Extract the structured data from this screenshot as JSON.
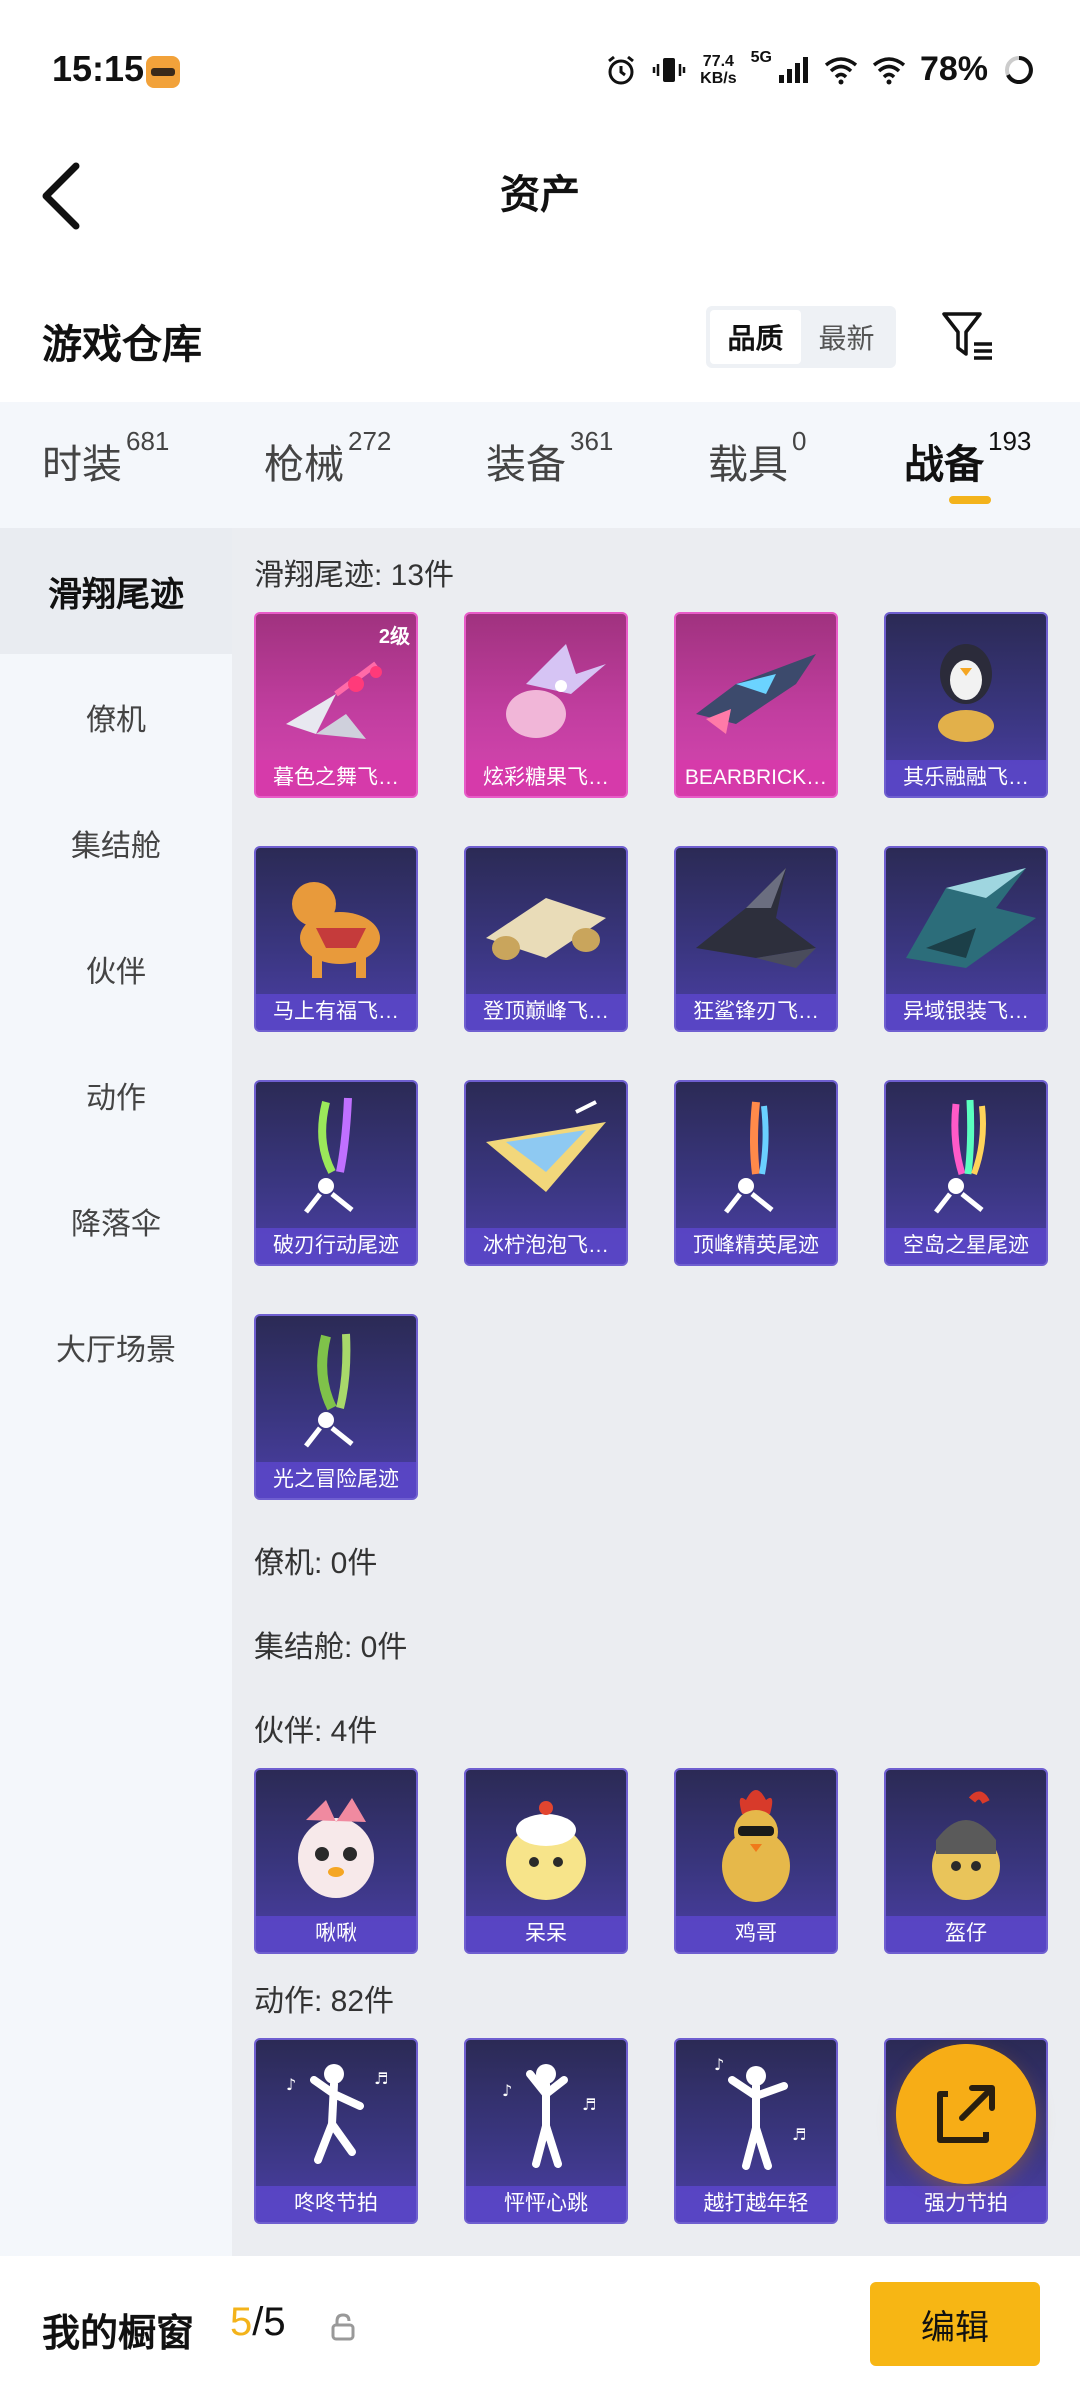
{
  "status_bar": {
    "time": "15:15",
    "net_speed_value": "77.4",
    "net_speed_unit": "KB/s",
    "network_type": "5G",
    "battery": "78%"
  },
  "header": {
    "title": "资产"
  },
  "warehouse": {
    "title": "游戏仓库",
    "sort_options": [
      "品质",
      "最新"
    ],
    "selected_sort": "品质"
  },
  "category_tabs": [
    {
      "label": "时装",
      "count": "681"
    },
    {
      "label": "枪械",
      "count": "272"
    },
    {
      "label": "装备",
      "count": "361"
    },
    {
      "label": "载具",
      "count": "0"
    },
    {
      "label": "战备",
      "count": "193",
      "active": true
    }
  ],
  "side_nav": [
    {
      "label": "滑翔尾迹",
      "active": true
    },
    {
      "label": "僚机"
    },
    {
      "label": "集结舱"
    },
    {
      "label": "伙伴"
    },
    {
      "label": "动作"
    },
    {
      "label": "降落伞"
    },
    {
      "label": "大厅场景"
    }
  ],
  "sections": {
    "glide_trails": {
      "label": "滑翔尾迹: 13件",
      "items": [
        {
          "name": "暮色之舞飞…",
          "level": "2级",
          "rarity": "pink"
        },
        {
          "name": "炫彩糖果飞…",
          "rarity": "pink"
        },
        {
          "name": "BEARBRICK…",
          "rarity": "pink"
        },
        {
          "name": "其乐融融飞…",
          "rarity": "purple"
        },
        {
          "name": "马上有福飞…",
          "rarity": "purple"
        },
        {
          "name": "登顶巅峰飞…",
          "rarity": "purple"
        },
        {
          "name": "狂鲨锋刃飞…",
          "rarity": "purple"
        },
        {
          "name": "异域银装飞…",
          "rarity": "purple"
        },
        {
          "name": "破刃行动尾迹",
          "rarity": "purple"
        },
        {
          "name": "冰柠泡泡飞…",
          "rarity": "purple"
        },
        {
          "name": "顶峰精英尾迹",
          "rarity": "purple"
        },
        {
          "name": "空岛之星尾迹",
          "rarity": "purple"
        },
        {
          "name": "光之冒险尾迹",
          "rarity": "purple"
        }
      ]
    },
    "wingman": {
      "label": "僚机: 0件"
    },
    "rally_pod": {
      "label": "集结舱: 0件"
    },
    "companions": {
      "label": "伙伴: 4件",
      "items": [
        {
          "name": "啾啾"
        },
        {
          "name": "呆呆"
        },
        {
          "name": "鸡哥"
        },
        {
          "name": "盔仔"
        }
      ]
    },
    "emotes": {
      "label": "动作: 82件",
      "items": [
        {
          "name": "咚咚节拍"
        },
        {
          "name": "怦怦心跳"
        },
        {
          "name": "越打越年轻"
        },
        {
          "name": "强力节拍"
        }
      ]
    }
  },
  "bottom_bar": {
    "title": "我的橱窗",
    "count_current": "5",
    "count_separator": "/",
    "count_total": "5",
    "edit_label": "编辑"
  },
  "colors": {
    "accent": "#f7b614",
    "card_purple": "#3a3680",
    "card_pink": "#c23ea0"
  }
}
